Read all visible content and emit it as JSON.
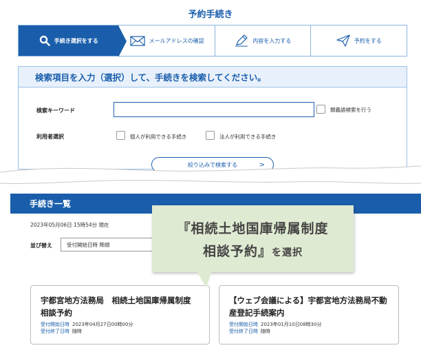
{
  "page_title": "予約手続き",
  "steps": [
    {
      "label": "手続き選択をする",
      "icon": "search-icon",
      "active": true
    },
    {
      "label": "メールアドレスの確認",
      "icon": "mail-icon",
      "active": false
    },
    {
      "label": "内容を入力する",
      "icon": "pencil-icon",
      "active": false
    },
    {
      "label": "予約をする",
      "icon": "send-icon",
      "active": false
    }
  ],
  "search": {
    "heading": "検索項目を入力（選択）して、手続きを検索してください。",
    "keyword_label": "検索キーワード",
    "keyword_value": "",
    "synonym_label": "類義語検索を行う",
    "user_label": "利用者選択",
    "individual_label": "個人が利用できる手続き",
    "corporate_label": "法人が利用できる手続き",
    "filter_button": "絞り込みで検索する",
    "filter_chevron": ">"
  },
  "list": {
    "heading": "手続き一覧",
    "as_of": "2023年05月06日 15時54分 現在",
    "sort_label": "並び替え",
    "sort_value": "受付開始日時 降順"
  },
  "callout": {
    "line1": "『相続土地国庫帰属制度",
    "line2": "相談予約』",
    "line2_suffix": "を選択"
  },
  "cards": [
    {
      "title": "宇都宮地方法務局　相続土地国庫帰属制度　相談予約",
      "start_key": "受付開始日時",
      "start_value": "2023年04月27日00時00分",
      "end_key": "受付終了日時",
      "end_value": "随時"
    },
    {
      "title": "【ウェブ会議による】宇都宮地方法務局不動産登記手続案内",
      "start_key": "受付開始日時",
      "start_value": "2023年01月10日08時30分",
      "end_key": "受付終了日時",
      "end_value": "随時"
    }
  ],
  "colors": {
    "primary": "#1a5eab",
    "callout_bg": "#dfead2"
  }
}
